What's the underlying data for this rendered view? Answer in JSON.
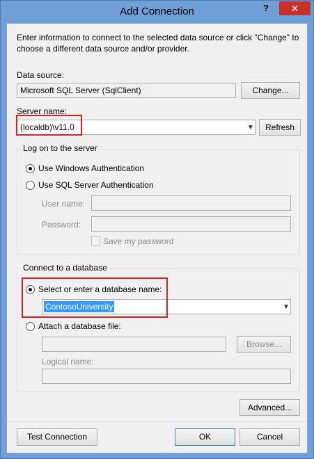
{
  "window": {
    "title": "Add Connection",
    "help": "?",
    "close": "✕"
  },
  "intro": {
    "line1": "Enter information to connect to the selected data source or click \"Change\" to",
    "line2": "choose a different data source and/or provider."
  },
  "data_source": {
    "label": "Data source:",
    "value": "Microsoft SQL Server (SqlClient)",
    "change": "Change..."
  },
  "server": {
    "label": "Server name:",
    "value": "(localdb)\\v11.0",
    "refresh": "Refresh"
  },
  "logon": {
    "group_label": "Log on to the server",
    "windows_auth": "Use Windows Authentication",
    "sql_auth": "Use SQL Server Authentication",
    "username_label": "User name:",
    "password_label": "Password:",
    "save_password": "Save my password"
  },
  "database": {
    "group_label": "Connect to a database",
    "select_label": "Select or enter a database name:",
    "db_name": "ContosoUniversity",
    "attach_label": "Attach a database file:",
    "browse": "Browse...",
    "logical_name_label": "Logical name:"
  },
  "buttons": {
    "advanced": "Advanced...",
    "test": "Test Connection",
    "ok": "OK",
    "cancel": "Cancel"
  },
  "colors": {
    "titlebar": "#6f9fd6",
    "close": "#c7312b",
    "highlight": "#e02020",
    "selection": "#3399ff"
  }
}
